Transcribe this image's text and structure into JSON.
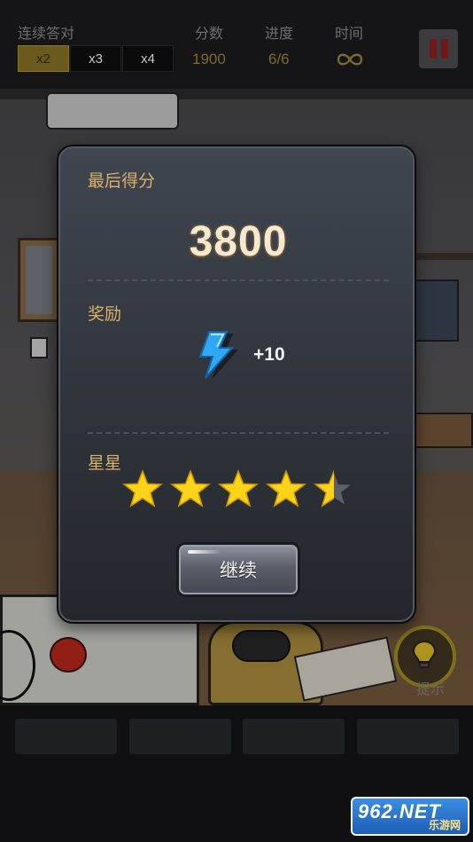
{
  "hud": {
    "combo_label": "连续答对",
    "combo_options": [
      "x2",
      "x3",
      "x4"
    ],
    "combo_active_index": 0,
    "score_label": "分数",
    "score_value": "1900",
    "progress_label": "进度",
    "progress_value": "6/6",
    "time_label": "时间",
    "time_icon": "infinity-icon",
    "pause_icon": "pause-icon",
    "accent_color": "#d9b06a",
    "pause_color": "#6e1818"
  },
  "result_dialog": {
    "final_score_title": "最后得分",
    "final_score": "3800",
    "reward_title": "奖励",
    "reward_icon": "lightning-bolt-icon",
    "reward_amount": "+10",
    "stars_title": "星星",
    "star_rating": 4.5,
    "star_max": 5,
    "continue_label": "继续"
  },
  "hint": {
    "label": "提示",
    "icon": "lightbulb-icon"
  },
  "bottom_slots": {
    "count": 4
  },
  "watermark": {
    "main": "962.NET",
    "sub": "乐游网"
  }
}
